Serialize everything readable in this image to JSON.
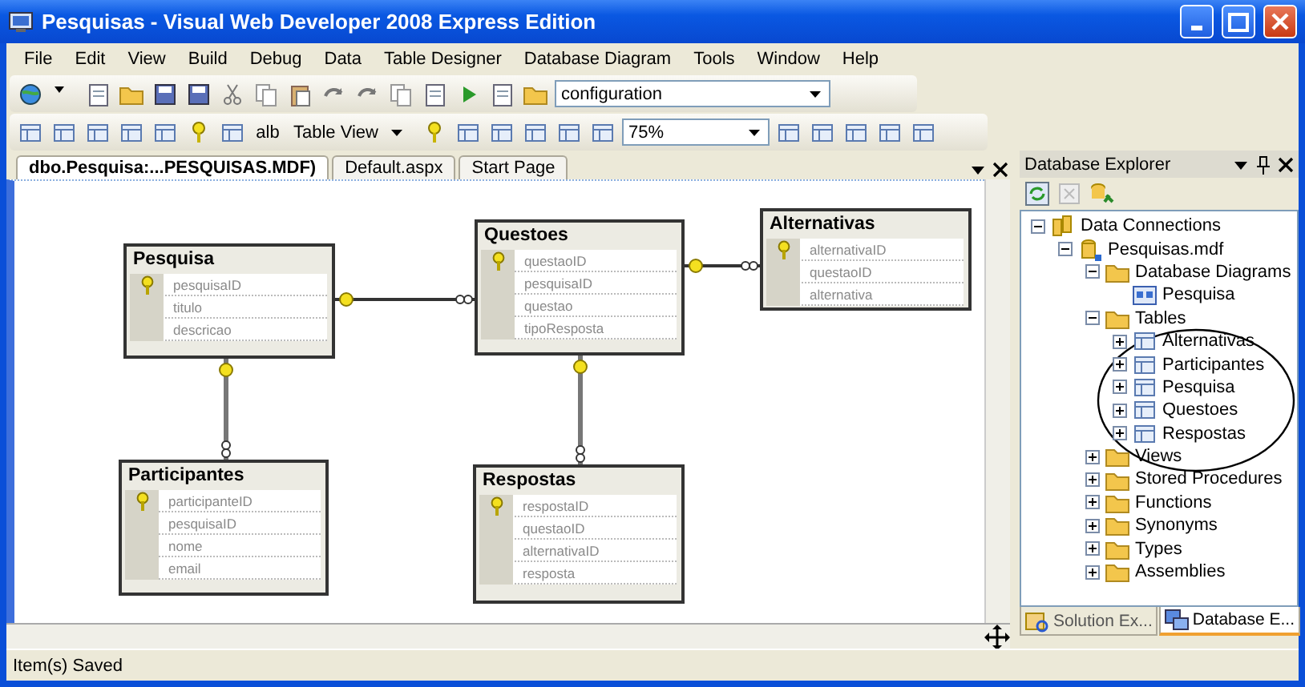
{
  "window": {
    "title": "Pesquisas - Visual Web Developer 2008 Express Edition"
  },
  "menu": [
    "File",
    "Edit",
    "View",
    "Build",
    "Debug",
    "Data",
    "Table Designer",
    "Database Diagram",
    "Tools",
    "Window",
    "Help"
  ],
  "toolbar_standard": {
    "configuration_combo": "configuration"
  },
  "toolbar_diagram": {
    "label_text": "alb",
    "table_view_button": "Table View",
    "zoom_combo": "75%"
  },
  "document_tabs": [
    {
      "label": "dbo.Pesquisa:...PESQUISAS.MDF)",
      "selected": true
    },
    {
      "label": "Default.aspx",
      "selected": false
    },
    {
      "label": "Start Page",
      "selected": false
    }
  ],
  "diagram": {
    "tables": [
      {
        "name": "Pesquisa",
        "columns": [
          {
            "name": "pesquisaID",
            "primary_key": true
          },
          {
            "name": "titulo",
            "primary_key": false
          },
          {
            "name": "descricao",
            "primary_key": false
          }
        ]
      },
      {
        "name": "Questoes",
        "columns": [
          {
            "name": "questaoID",
            "primary_key": true
          },
          {
            "name": "pesquisaID",
            "primary_key": false
          },
          {
            "name": "questao",
            "primary_key": false
          },
          {
            "name": "tipoResposta",
            "primary_key": false
          }
        ]
      },
      {
        "name": "Alternativas",
        "columns": [
          {
            "name": "alternativaID",
            "primary_key": true
          },
          {
            "name": "questaoID",
            "primary_key": false
          },
          {
            "name": "alternativa",
            "primary_key": false
          }
        ]
      },
      {
        "name": "Participantes",
        "columns": [
          {
            "name": "participanteID",
            "primary_key": true
          },
          {
            "name": "pesquisaID",
            "primary_key": false
          },
          {
            "name": "nome",
            "primary_key": false
          },
          {
            "name": "email",
            "primary_key": false
          }
        ]
      },
      {
        "name": "Respostas",
        "columns": [
          {
            "name": "respostaID",
            "primary_key": true
          },
          {
            "name": "questaoID",
            "primary_key": false
          },
          {
            "name": "alternativaID",
            "primary_key": false
          },
          {
            "name": "resposta",
            "primary_key": false
          }
        ]
      }
    ]
  },
  "explorer": {
    "title": "Database Explorer",
    "tree": [
      {
        "label": "Data Connections",
        "kind": "connections",
        "expanded": true,
        "children": [
          {
            "label": "Pesquisas.mdf",
            "kind": "database",
            "expanded": true,
            "children": [
              {
                "label": "Database Diagrams",
                "kind": "folder",
                "expanded": true,
                "children": [
                  {
                    "label": "Pesquisa",
                    "kind": "diagram"
                  }
                ]
              },
              {
                "label": "Tables",
                "kind": "folder",
                "expanded": true,
                "children": [
                  {
                    "label": "Alternativas",
                    "kind": "table",
                    "expanded": false
                  },
                  {
                    "label": "Participantes",
                    "kind": "table",
                    "expanded": false
                  },
                  {
                    "label": "Pesquisa",
                    "kind": "table",
                    "expanded": false
                  },
                  {
                    "label": "Questoes",
                    "kind": "table",
                    "expanded": false
                  },
                  {
                    "label": "Respostas",
                    "kind": "table",
                    "expanded": false
                  }
                ]
              },
              {
                "label": "Views",
                "kind": "folder",
                "expanded": false
              },
              {
                "label": "Stored Procedures",
                "kind": "folder",
                "expanded": false
              },
              {
                "label": "Functions",
                "kind": "folder",
                "expanded": false
              },
              {
                "label": "Synonyms",
                "kind": "folder",
                "expanded": false
              },
              {
                "label": "Types",
                "kind": "folder",
                "expanded": false
              },
              {
                "label": "Assemblies",
                "kind": "folder",
                "expanded": false
              }
            ]
          }
        ]
      }
    ],
    "bottom_tabs": [
      {
        "label": "Solution Ex...",
        "kind": "solution",
        "selected": false
      },
      {
        "label": "Database E...",
        "kind": "database",
        "selected": true
      }
    ]
  },
  "status_bar": "Item(s) Saved"
}
